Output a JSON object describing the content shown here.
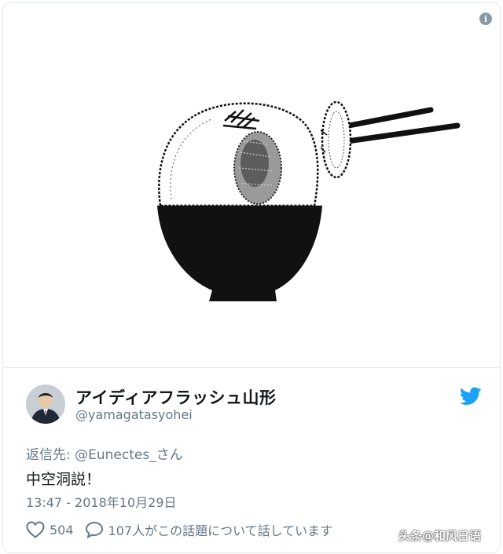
{
  "tweet": {
    "display_name": "アイディアフラッシュ山形",
    "handle": "@yamagatasyohei",
    "reply_to": "返信先: @Eunectes_さん",
    "text": "中空洞説！",
    "timestamp": "13:47 - 2018年10月29日",
    "like_count": "504",
    "talk_text": "107人がこの話題について話しています"
  },
  "icons": {
    "info": "info-icon",
    "brand": "twitter-bird-icon",
    "like": "heart-icon",
    "reply": "speech-bubble-icon"
  },
  "colors": {
    "brand": "#1da1f2",
    "muted": "#657786",
    "text": "#14171a"
  },
  "watermark": "头条@和风日语"
}
